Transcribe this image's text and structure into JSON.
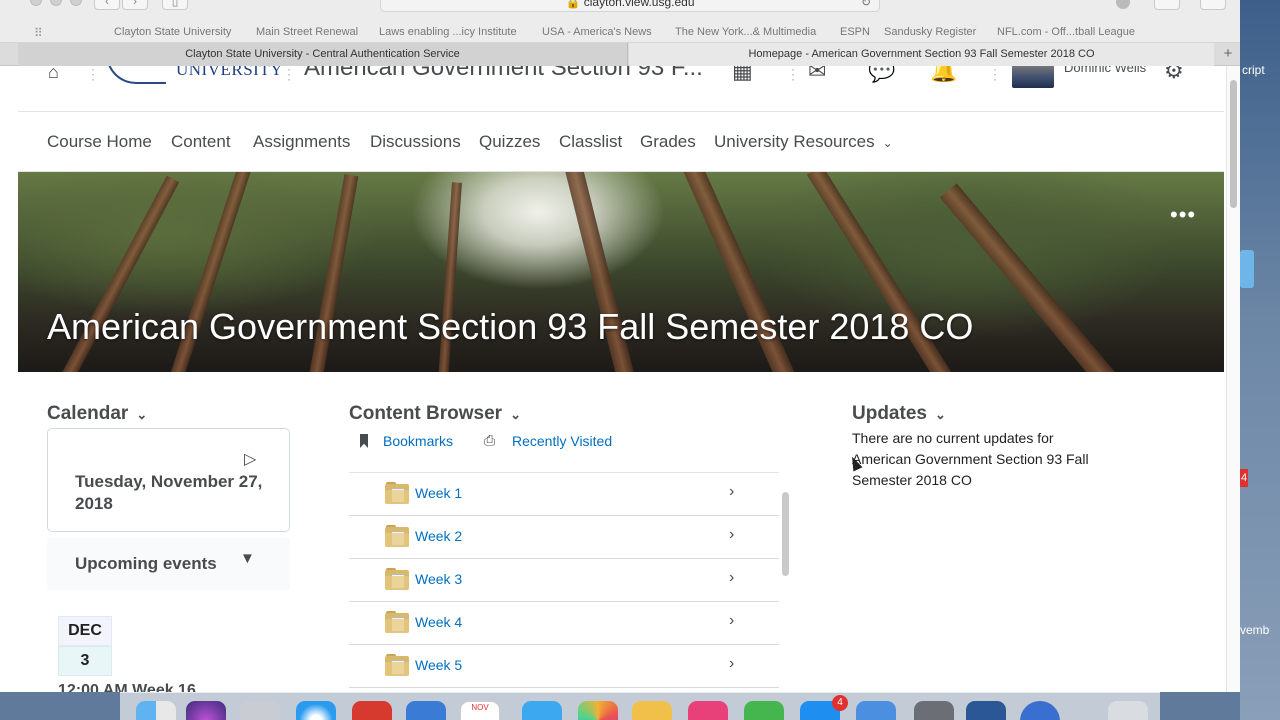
{
  "browser": {
    "url": "clayton.view.usg.edu",
    "favorites": [
      "Clayton State University",
      "Main Street Renewal",
      "Laws enabling ...icy Institute",
      "USA - America's News",
      "The New York...& Multimedia",
      "ESPN",
      "Sandusky Register",
      "NFL.com - Off...tball League"
    ],
    "tabs": [
      "Clayton State University - Central Authentication Service",
      "Homepage - American Government Section 93 Fall Semester 2018 CO"
    ],
    "new_tab": "+"
  },
  "header": {
    "logo_text": "UNIVERSITY",
    "course_title": "American Government Section 93 F...",
    "user_name": "Dominic Wells"
  },
  "nav": {
    "items": [
      "Course Home",
      "Content",
      "Assignments",
      "Discussions",
      "Quizzes",
      "Classlist",
      "Grades",
      "University Resources"
    ]
  },
  "banner": {
    "title": "American Government Section 93 Fall Semester 2018 CO",
    "more": "•••"
  },
  "calendar": {
    "heading": "Calendar",
    "date": "Tuesday, November 27, 2018",
    "upcoming_label": "Upcoming events",
    "event_month": "DEC",
    "event_day": "3",
    "event_time": "12:00 AM  Week 16"
  },
  "content_browser": {
    "heading": "Content Browser",
    "bookmarks": "Bookmarks",
    "recently_visited": "Recently Visited",
    "modules": [
      "Week 1",
      "Week 2",
      "Week 3",
      "Week 4",
      "Week 5"
    ]
  },
  "updates": {
    "heading": "Updates",
    "message": "There are no current updates for American Government Section 93 Fall Semester 2018 CO"
  },
  "desktop": {
    "frag_top": "cript",
    "frag_bottom": "vemb",
    "badge_side": "4"
  },
  "dock": {
    "calendar_month": "NOV",
    "app_store_badge": "4"
  },
  "colors": {
    "link": "#006fbf",
    "text": "#494c4e"
  }
}
